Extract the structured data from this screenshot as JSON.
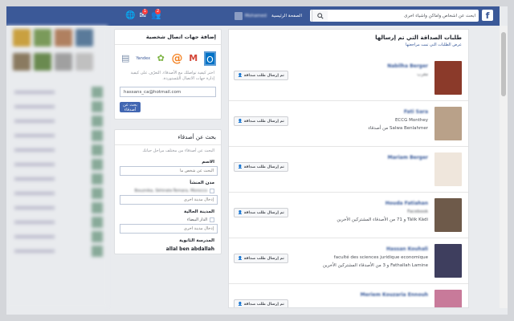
{
  "topbar": {
    "search_placeholder": "ابحث عن أشخاص وأماكن وأشياء أخرى",
    "home_label": "الصفحة الرئيسية",
    "profile_name": "Mohamed",
    "friend_requests_badge": "2",
    "messages_badge": "1"
  },
  "import_card": {
    "title": "إضافة جهات اتصال شخصية",
    "description": "اختر كيفية تواصلك مع الأصدقاء. التعرّف على كيفية إدارة جهات الاتصال المُستوردة.",
    "email_value": "hassans_ca@hotmail.com",
    "find_button": "بحث عن أصدقاء",
    "providers": [
      "outlook-icon",
      "gmail-icon",
      "at-sign-icon",
      "icq-icon",
      "yandex-icon",
      "other-provider-icon"
    ]
  },
  "search_card": {
    "title": "بحث عن أصدقاء",
    "subtitle": "البحث عن أصدقاء من مختلف مراحل حياتك",
    "name_label": "الاسم",
    "name_placeholder": "البحث عن شخص ما",
    "hometown_label": "مدن المنشأ",
    "hometown_value": "Bouznika, Skhirate-Temara, Morocco",
    "hometown_placeholder": "إدخال مدينة أخرى",
    "current_city_label": "المدينة الحالية",
    "current_city_value": "الدار البيضاء",
    "current_city_placeholder": "إدخال مدينة أخرى",
    "school_label": "المدرسة الثانوية",
    "school_value": "allal ben abdallah"
  },
  "main": {
    "title": "طلبات الصداقة التي تم إرسالها",
    "link": "عرض الطلبات التي تمت مراجعتها",
    "button_label": "تم إرسال طلب صداقة",
    "requests": [
      {
        "name": "Nabilha Berger",
        "line1": "مغرب",
        "line2": ""
      },
      {
        "name": "Fati Sara",
        "line1": "ECCG Monthey",
        "line2": "Salwa Benlahmer من أصدقاء"
      },
      {
        "name": "Mariam Berger",
        "line1": "",
        "line2": ""
      },
      {
        "name": "Houda Fatiahan",
        "line1": "Facebook",
        "line2": "Tàlik Kàdi و 71 من الأصدقاء المشتركين الأخرين"
      },
      {
        "name": "Hassan Kouhali",
        "line1": "faculté des sciences juridique economique",
        "line2": "Fathallah Lamine و 3 من الأصدقاء المشتركين الأخرين"
      },
      {
        "name": "Meriem Kouzaria Ennouh",
        "line1": "",
        "line2": ""
      }
    ]
  },
  "colors": {
    "brand": "#3b5998",
    "link": "#365899",
    "badge": "#fa3e3e"
  }
}
